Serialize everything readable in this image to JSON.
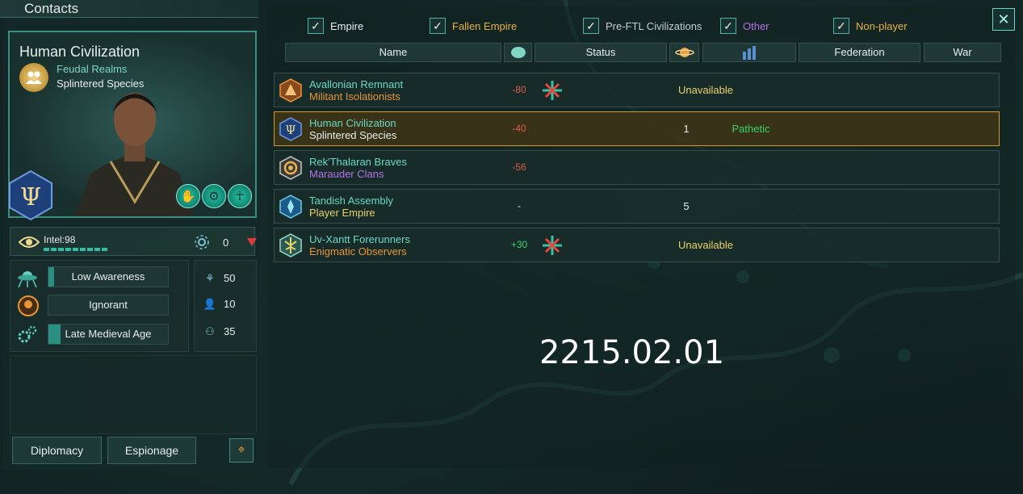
{
  "window": {
    "title": "Contacts"
  },
  "profile": {
    "name": "Human Civilization",
    "type": "Feudal Realms",
    "species": "Splintered Species",
    "intel_label": "Intel:98",
    "intel_level": 0.98,
    "intel_contacts": "0",
    "awareness": "Low Awareness",
    "awareness_fill": 0.05,
    "attitude": "Ignorant",
    "attitude_fill": 0.0,
    "tech_age": "Late Medieval Age",
    "tech_fill": 0.1,
    "stats": [
      "50",
      "10",
      "35"
    ],
    "buttons": {
      "diplomacy": "Diplomacy",
      "espionage": "Espionage"
    }
  },
  "filters": [
    {
      "label": "Empire",
      "color": "#e8eeec"
    },
    {
      "label": "Fallen Empire",
      "color": "#e8b14a"
    },
    {
      "label": "Pre-FTL Civilizations",
      "color": "#c8cfcd"
    },
    {
      "label": "Other",
      "color": "#b472e8"
    },
    {
      "label": "Non-player",
      "color": "#e8b14a"
    }
  ],
  "columns": {
    "name": "Name",
    "status": "Status",
    "federation": "Federation",
    "war": "War"
  },
  "rows": [
    {
      "name": "Avallonian Remnant",
      "type": "Militant Isolationists",
      "type_color": "#e8953a",
      "opinion": "-80",
      "opinion_color": "#e05a4a",
      "no_contact": true,
      "status": "Unavailable",
      "status_color": "#e8d36a",
      "planets": "",
      "relation": "",
      "relation_color": "#ffffff"
    },
    {
      "name": "Human Civilization",
      "type": "Splintered Species",
      "type_color": "#e8eeec",
      "opinion": "-40",
      "opinion_color": "#e05a4a",
      "no_contact": false,
      "status": "",
      "status_color": "#e8d36a",
      "planets": "1",
      "relation": "Pathetic",
      "relation_color": "#3cd26a"
    },
    {
      "name": "Rek'Thalaran Braves",
      "type": "Marauder Clans",
      "type_color": "#b472e8",
      "opinion": "-56",
      "opinion_color": "#e05a4a",
      "no_contact": false,
      "status": "",
      "status_color": "#e8d36a",
      "planets": "",
      "relation": "",
      "relation_color": "#ffffff"
    },
    {
      "name": "Tandish Assembly",
      "type": "Player Empire",
      "type_color": "#e8d36a",
      "opinion": "-",
      "opinion_color": "#e8eeec",
      "no_contact": false,
      "status": "",
      "status_color": "#e8d36a",
      "planets": "5",
      "relation": "",
      "relation_color": "#ffffff"
    },
    {
      "name": "Uv-Xantt Forerunners",
      "type": "Enigmatic Observers",
      "type_color": "#e8953a",
      "opinion": "+30",
      "opinion_color": "#3cd26a",
      "no_contact": true,
      "status": "Unavailable",
      "status_color": "#e8d36a",
      "planets": "",
      "relation": "",
      "relation_color": "#ffffff"
    }
  ],
  "date": "2215.02.01"
}
